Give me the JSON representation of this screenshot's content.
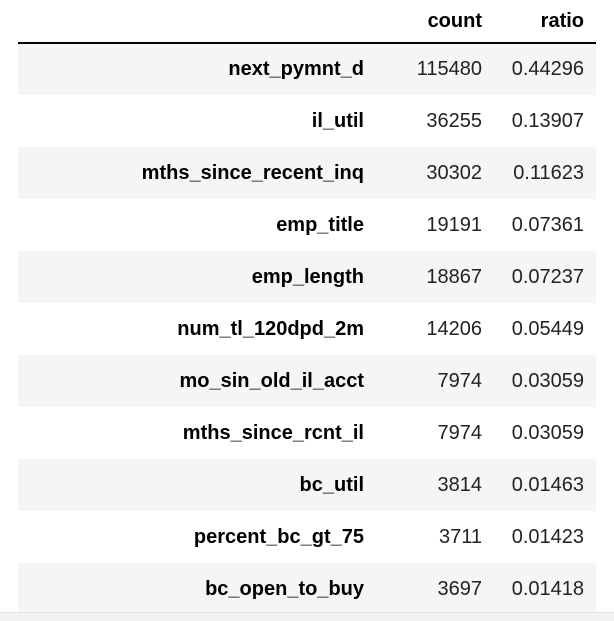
{
  "table": {
    "headers": {
      "index": "",
      "count": "count",
      "ratio": "ratio"
    },
    "rows": [
      {
        "name": "next_pymnt_d",
        "count": "115480",
        "ratio": "0.44296"
      },
      {
        "name": "il_util",
        "count": "36255",
        "ratio": "0.13907"
      },
      {
        "name": "mths_since_recent_inq",
        "count": "30302",
        "ratio": "0.11623"
      },
      {
        "name": "emp_title",
        "count": "19191",
        "ratio": "0.07361"
      },
      {
        "name": "emp_length",
        "count": "18867",
        "ratio": "0.07237"
      },
      {
        "name": "num_tl_120dpd_2m",
        "count": "14206",
        "ratio": "0.05449"
      },
      {
        "name": "mo_sin_old_il_acct",
        "count": "7974",
        "ratio": "0.03059"
      },
      {
        "name": "mths_since_rcnt_il",
        "count": "7974",
        "ratio": "0.03059"
      },
      {
        "name": "bc_util",
        "count": "3814",
        "ratio": "0.01463"
      },
      {
        "name": "percent_bc_gt_75",
        "count": "3711",
        "ratio": "0.01423"
      },
      {
        "name": "bc_open_to_buy",
        "count": "3697",
        "ratio": "0.01418"
      }
    ]
  },
  "colors": {
    "stripe": "#f5f5f5",
    "header_border": "#000000"
  }
}
